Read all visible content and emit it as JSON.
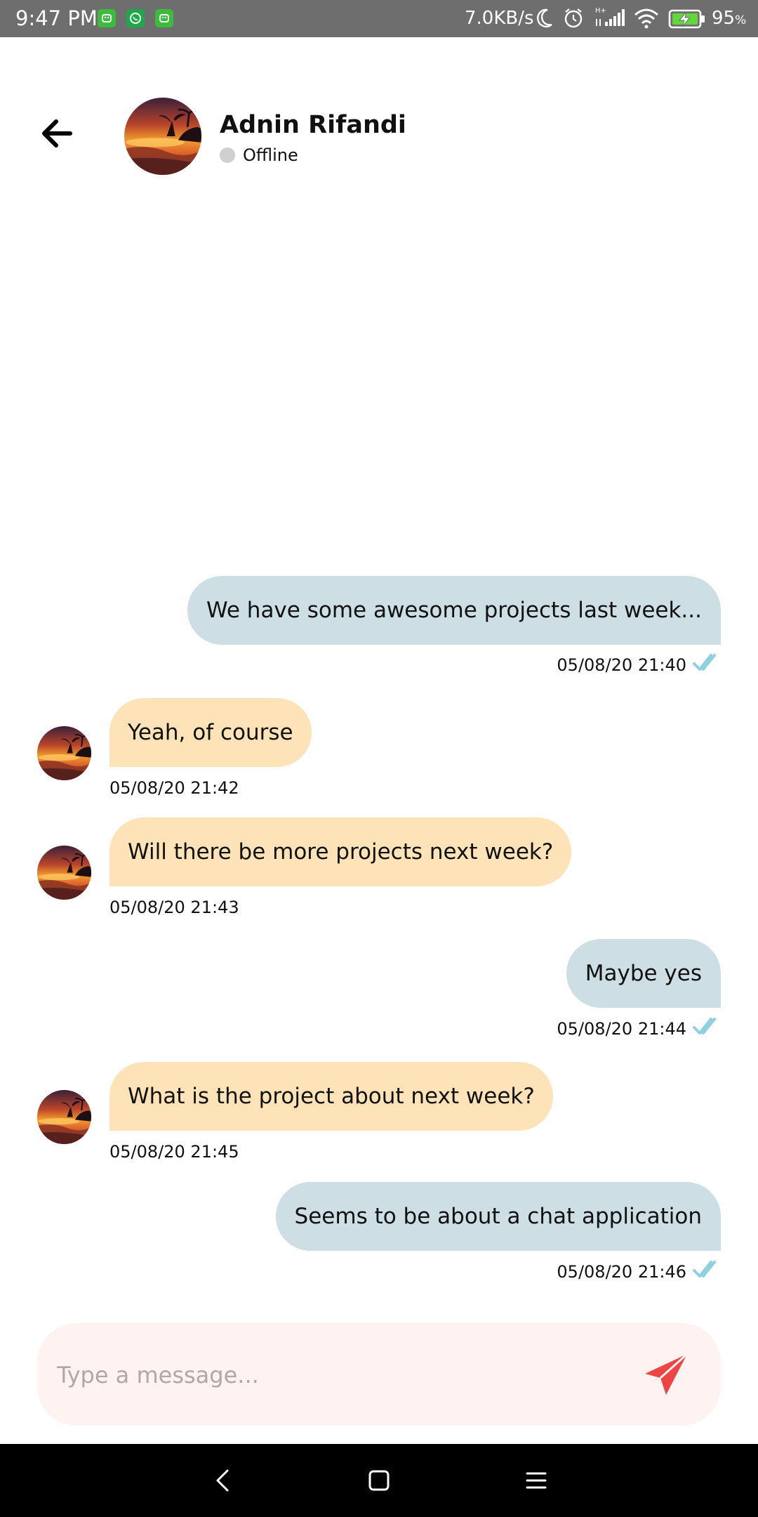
{
  "status_bar": {
    "time": "9:47 PM",
    "net_speed": "7.0KB/s",
    "battery_percent": "95",
    "battery_percent_sign": "%",
    "network_type": "H+",
    "icons": [
      "android-notification-icon",
      "whatsapp-icon",
      "android-notification-icon",
      "moon-icon",
      "alarm-icon",
      "signal-icon",
      "wifi-icon",
      "battery-charging-icon"
    ]
  },
  "header": {
    "contact_name": "Adnin Rifandi",
    "status": "Offline"
  },
  "messages": [
    {
      "direction": "sent",
      "text": "We have some awesome projects last week...",
      "time": "05/08/20 21:40",
      "read": true
    },
    {
      "direction": "received",
      "text": "Yeah, of course",
      "time": "05/08/20 21:42"
    },
    {
      "direction": "received",
      "text": "Will there be more projects next week?",
      "time": "05/08/20 21:43"
    },
    {
      "direction": "sent",
      "text": "Maybe yes",
      "time": "05/08/20 21:44",
      "read": true
    },
    {
      "direction": "received",
      "text": "What is the project about next week?",
      "time": "05/08/20 21:45"
    },
    {
      "direction": "sent",
      "text": "Seems to be about a chat application",
      "time": "05/08/20 21:46",
      "read": true
    }
  ],
  "composer": {
    "placeholder": "Type a message...",
    "value": ""
  },
  "colors": {
    "sent_bubble": "#cddfe4",
    "received_bubble": "#fde3b7",
    "composer_background": "#fff3f1",
    "send_icon": "#ee4444",
    "read_check": "#8fd0e0",
    "offline_dot": "#d0d0d0"
  }
}
